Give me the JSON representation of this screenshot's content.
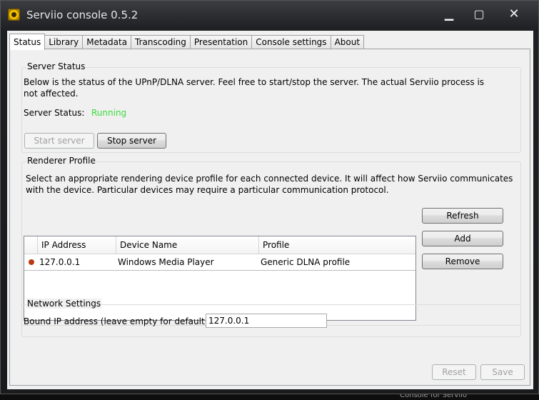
{
  "window": {
    "title": "Serviio console 0.5.2"
  },
  "desktop": {
    "behind_text": "Console for Serviio"
  },
  "tabs": [
    "Status",
    "Library",
    "Metadata",
    "Transcoding",
    "Presentation",
    "Console settings",
    "About"
  ],
  "server_status": {
    "group_title": "Server Status",
    "description": "Below is the status of the UPnP/DLNA server. Feel free to start/stop the server. The actual Serviio process is not affected.",
    "status_label": "Server Status:",
    "status_value": "Running",
    "start_button": "Start server",
    "stop_button": "Stop server"
  },
  "renderer_profile": {
    "group_title": "Renderer Profile",
    "description": "Select an appropriate rendering device profile for each connected device. It will affect how Serviio communicates with the device. Particular devices may require a particular communication protocol.",
    "columns": [
      "IP Address",
      "Device Name",
      "Profile"
    ],
    "rows": [
      {
        "ip": "127.0.0.1",
        "device": "Windows Media Player",
        "profile": "Generic DLNA profile",
        "status_color": "#b83a10"
      }
    ],
    "refresh_button": "Refresh",
    "add_button": "Add",
    "remove_button": "Remove"
  },
  "network_settings": {
    "group_title": "Network Settings",
    "bound_ip_label": "Bound IP address (leave empty for default):",
    "bound_ip_value": "127.0.0.1"
  },
  "footer": {
    "reset_button": "Reset",
    "save_button": "Save"
  },
  "colors": {
    "running": "#3adb3a",
    "titlebar": "#2a2b2e"
  }
}
